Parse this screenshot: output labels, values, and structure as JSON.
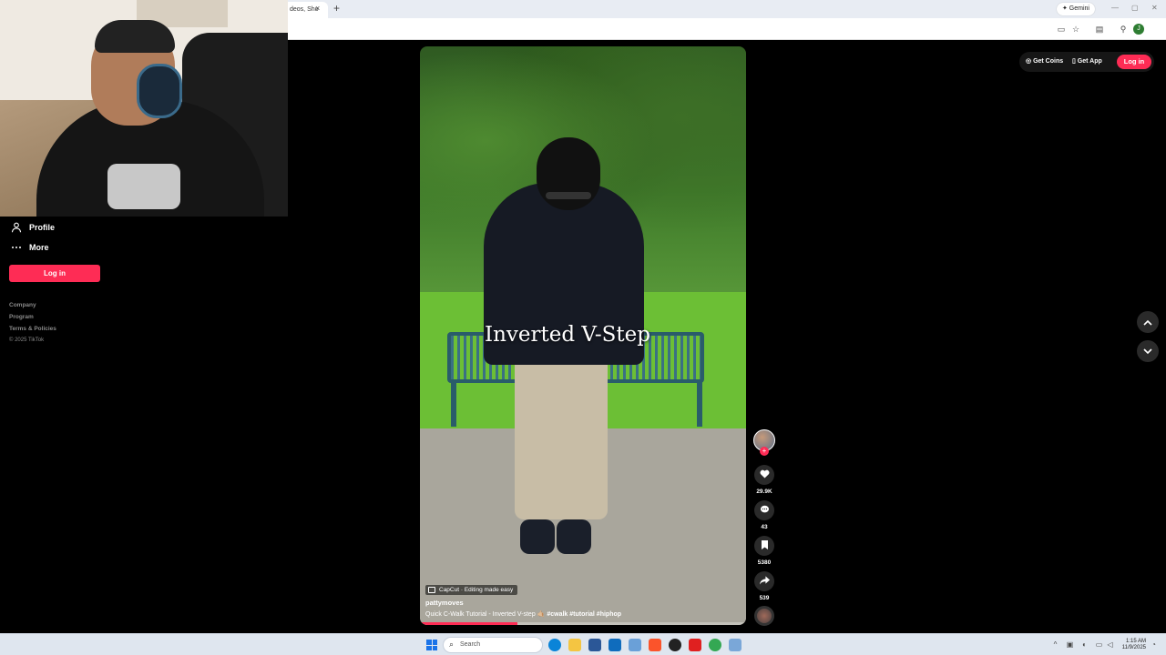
{
  "browser": {
    "tab_title": "deos, Sho",
    "tab_close": "×",
    "new_tab": "+",
    "gemini_label": "✦ Gemini",
    "window_controls": [
      "—",
      "▢",
      "✕"
    ],
    "profile_initial": "J"
  },
  "sidebar": {
    "items": [
      {
        "label": "Profile",
        "icon": "person-icon"
      },
      {
        "label": "More",
        "icon": "more-dots-icon"
      }
    ],
    "login_label": "Log in",
    "footer": {
      "links": [
        "Company",
        "Program",
        "Terms & Policies"
      ],
      "copyright": "© 2025 TikTok"
    }
  },
  "header": {
    "get_coins": "Get Coins",
    "get_app": "Get App",
    "login": "Log in"
  },
  "video": {
    "overlay_text": "Inverted V-Step",
    "capcut_label": "CapCut · Editing made easy",
    "author": "pattymoves",
    "caption_text": "Quick C-Walk Tutorial - Inverted V-step 🤙🏼",
    "hashtags": "#cwalk #tutorial #hiphop",
    "progress": 0.3
  },
  "actions": {
    "likes": "29.9K",
    "comments": "43",
    "saves": "5380",
    "shares": "539"
  },
  "colors": {
    "brand": "#fe2c55",
    "background": "#000000"
  },
  "taskbar": {
    "search_label": "Search",
    "time": "1:15 AM",
    "date": "11/9/2025"
  }
}
